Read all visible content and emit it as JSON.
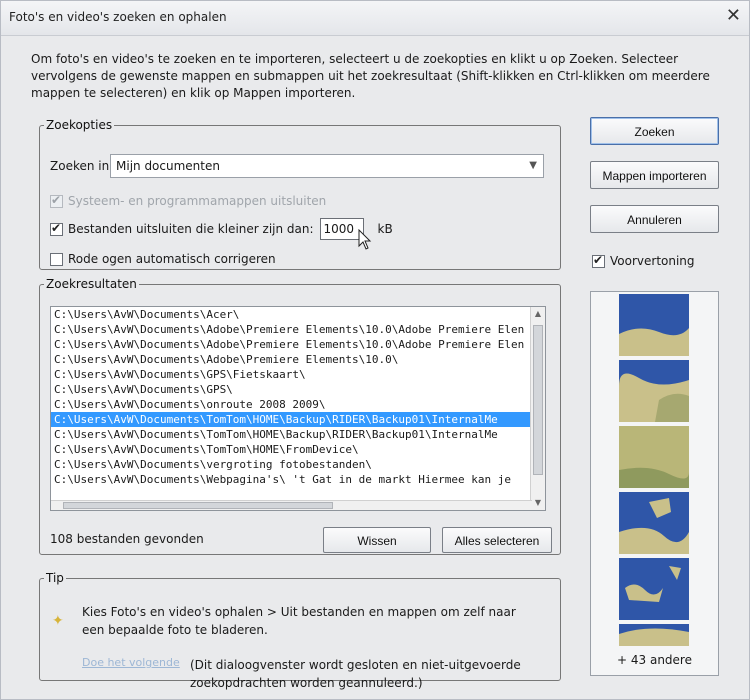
{
  "window": {
    "title": "Foto's en video's zoeken en ophalen",
    "close_glyph": "✕"
  },
  "intro": "Om foto's en video's te zoeken en te importeren, selecteert u de zoekopties en klikt u op Zoeken. Selecteer vervolgens de gewenste mappen en submappen uit het zoekresultaat (Shift-klikken en Ctrl-klikken om meerdere mappen te selecteren) en klik op Mappen importeren.",
  "options": {
    "legend": "Zoekopties",
    "search_in_label": "Zoeken in:",
    "search_in_value": "Mijn documenten",
    "exclude_system_label": "Systeem- en programmamappen uitsluiten",
    "exclude_system_checked": true,
    "exclude_system_disabled": true,
    "exclude_small_label": "Bestanden uitsluiten die kleiner zijn dan:",
    "exclude_small_checked": true,
    "exclude_small_value": "1000",
    "exclude_small_unit": "kB",
    "redeye_label": "Rode ogen automatisch corrigeren",
    "redeye_checked": false
  },
  "results": {
    "legend": "Zoekresultaten",
    "items": [
      "C:\\Users\\AvW\\Documents\\Acer\\",
      "C:\\Users\\AvW\\Documents\\Adobe\\Premiere Elements\\10.0\\Adobe Premiere Elen",
      "C:\\Users\\AvW\\Documents\\Adobe\\Premiere Elements\\10.0\\Adobe Premiere Elen",
      "C:\\Users\\AvW\\Documents\\Adobe\\Premiere Elements\\10.0\\",
      "C:\\Users\\AvW\\Documents\\GPS\\Fietskaart\\",
      "C:\\Users\\AvW\\Documents\\GPS\\",
      "C:\\Users\\AvW\\Documents\\onroute 2008 2009\\",
      "C:\\Users\\AvW\\Documents\\TomTom\\HOME\\Backup\\RIDER\\Backup01\\InternalMe",
      "C:\\Users\\AvW\\Documents\\TomTom\\HOME\\Backup\\RIDER\\Backup01\\InternalMe",
      "C:\\Users\\AvW\\Documents\\TomTom\\HOME\\FromDevice\\",
      "C:\\Users\\AvW\\Documents\\vergroting fotobestanden\\",
      "C:\\Users\\AvW\\Documents\\Webpagina's\\ 't Gat in de markt    Hiermee kan je"
    ],
    "selected_index": 7,
    "found_text": "108 bestanden gevonden",
    "clear_label": "Wissen",
    "select_all_label": "Alles selecteren"
  },
  "tip": {
    "legend": "Tip",
    "text": "Kies Foto's en video's ophalen > Uit bestanden en mappen om zelf naar een bepaalde foto te bladeren.",
    "link": "Doe het volgende",
    "note": "(Dit dialoogvenster wordt gesloten en niet-uitgevoerde zoekopdrachten worden geannuleerd.)"
  },
  "buttons": {
    "search": "Zoeken",
    "import_folders": "Mappen importeren",
    "cancel": "Annuleren"
  },
  "preview": {
    "label": "Voorvertoning",
    "checked": true,
    "more_text": "+ 43 andere",
    "water_color": "#2f56a8",
    "land_color": "#c9c08a"
  }
}
